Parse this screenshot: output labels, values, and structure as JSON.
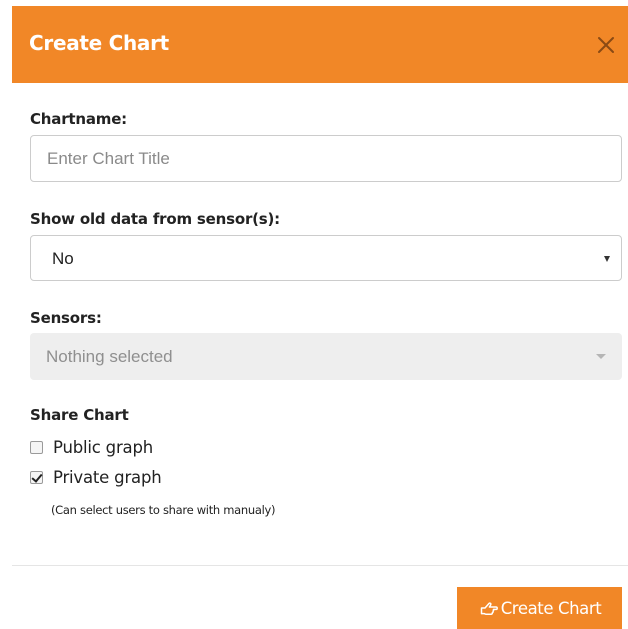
{
  "dialog": {
    "title": "Create Chart",
    "close_icon": "close-icon"
  },
  "form": {
    "chartname": {
      "label": "Chartname:",
      "value": "",
      "placeholder": "Enter Chart Title"
    },
    "show_old_data": {
      "label": "Show old data from sensor(s):",
      "selected": "No"
    },
    "sensors": {
      "label": "Sensors:",
      "selected": "Nothing selected",
      "disabled": true
    },
    "share": {
      "label": "Share Chart",
      "options": [
        {
          "label": "Public graph",
          "checked": false
        },
        {
          "label": "Private graph",
          "checked": true
        }
      ],
      "hint": "(Can select users to share with manualy)"
    }
  },
  "footer": {
    "create_label": "Create Chart",
    "create_icon": "hand-pointing-right-icon"
  },
  "colors": {
    "accent": "#f18727",
    "disabled_bg": "#eeeeee",
    "border": "#cccccc"
  }
}
